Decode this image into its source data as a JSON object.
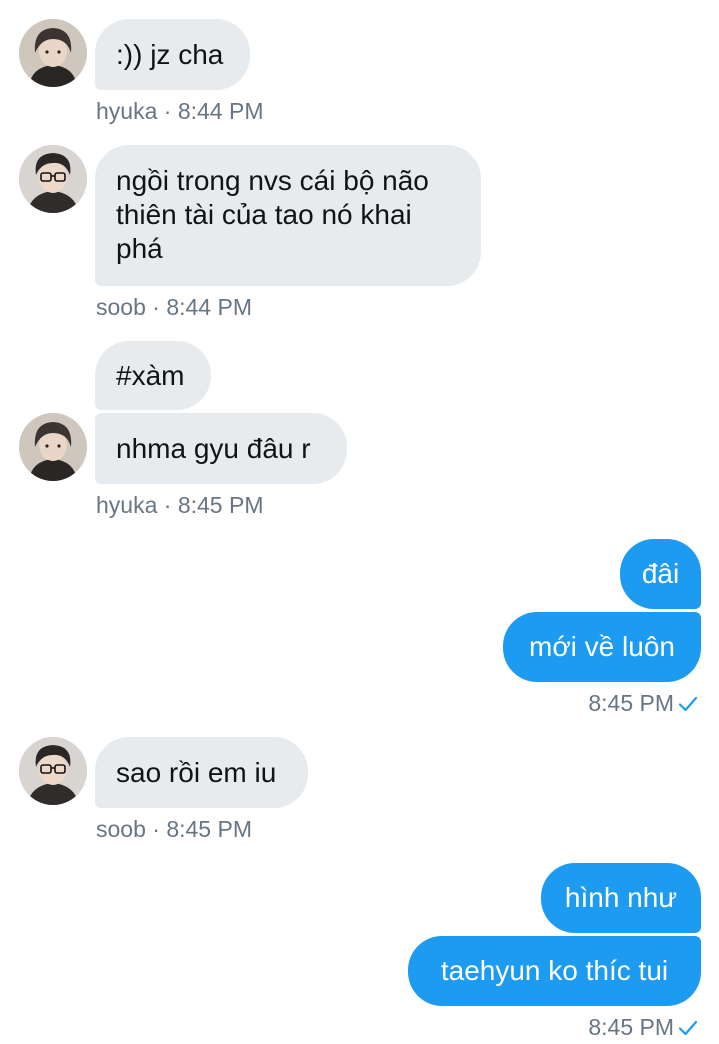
{
  "messages": [
    {
      "sender": "hyuka",
      "time": "8:44 PM",
      "text": ":)) jz cha"
    },
    {
      "sender": "soob",
      "time": "8:44 PM",
      "text": "ngồi trong nvs cái bộ não thiên tài của tao nó khai phá"
    },
    {
      "sender": "hyuka",
      "time": "8:45 PM",
      "texts": [
        "#xàm",
        "nhma gyu đâu r"
      ]
    },
    {
      "sender": "me",
      "time": "8:45 PM",
      "texts": [
        "đâi",
        "mới về luôn"
      ]
    },
    {
      "sender": "soob",
      "time": "8:45 PM",
      "text": "sao rồi em iu"
    },
    {
      "sender": "me",
      "time": "8:45 PM",
      "texts": [
        "hình như",
        "taehyun ko thíc tui"
      ]
    }
  ],
  "meta_separator": "·",
  "colors": {
    "incoming_bubble": "#e7ebee",
    "outgoing_bubble": "#1d9bf0",
    "meta_text": "#687684",
    "read_check": "#1d9bf0"
  },
  "icons": {
    "read_receipt": "checkmark-icon",
    "avatar_hyuka": "profile-photo",
    "avatar_soob": "profile-photo-glasses"
  }
}
